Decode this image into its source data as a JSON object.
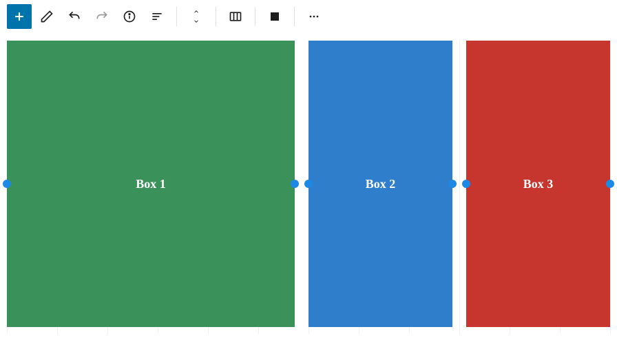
{
  "toolbar": {
    "add_label": "Add block",
    "edit_label": "Edit",
    "undo_label": "Undo",
    "redo_label": "Redo",
    "info_label": "Document info",
    "outline_label": "Outline",
    "move_up_label": "Move up",
    "move_down_label": "Move down",
    "columns_label": "Columns",
    "color_label": "Color",
    "more_label": "More options"
  },
  "columns": [
    {
      "label": "Box 1",
      "color": "#3a9159",
      "flex": 2
    },
    {
      "label": "Box 2",
      "color": "#2f7ecc",
      "flex": 1
    },
    {
      "label": "Box 3",
      "color": "#c6352e",
      "flex": 1
    }
  ],
  "handle_color": "#1e88e5"
}
